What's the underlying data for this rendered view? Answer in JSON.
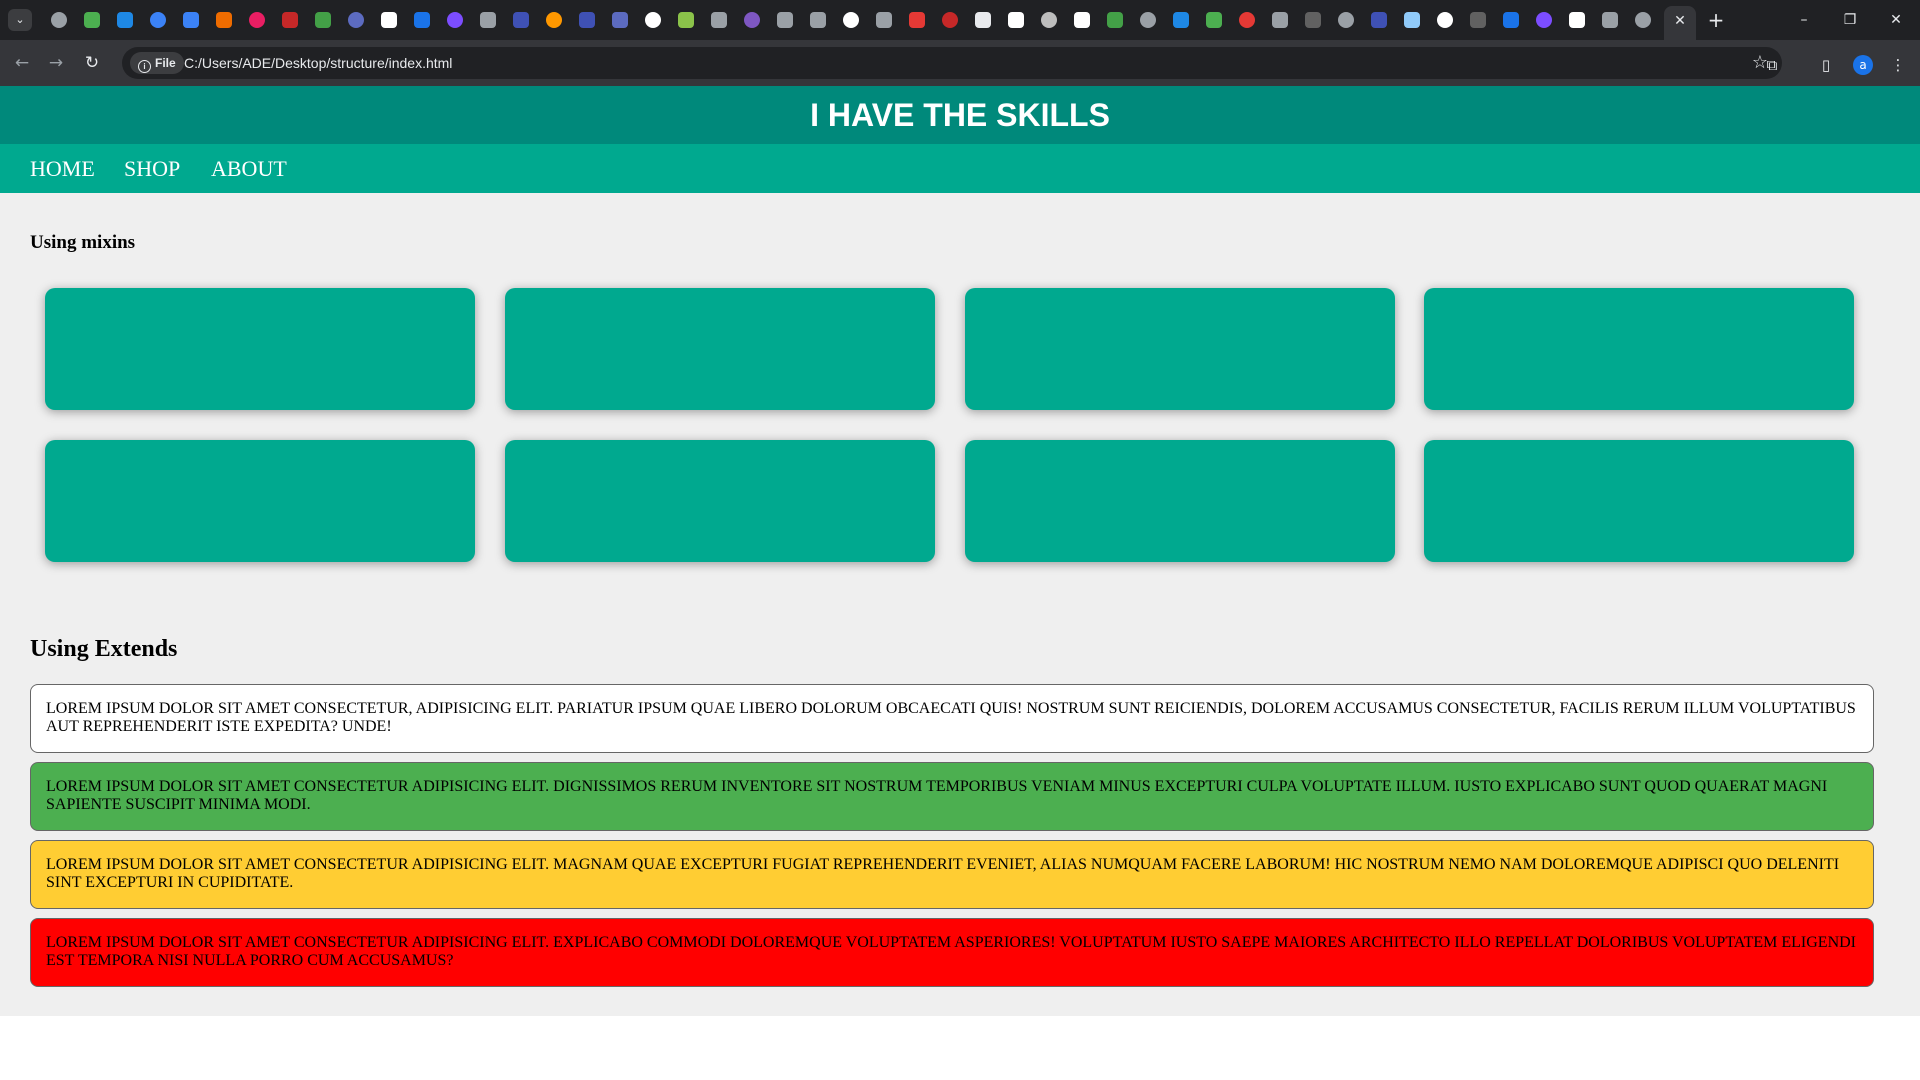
{
  "browser": {
    "tab_menu_glyph": "⌄",
    "active_tab_close": "✕",
    "new_tab": "+",
    "window_controls": {
      "minimize": "–",
      "restore": "❐",
      "close": "✕"
    },
    "file_chip": "File",
    "url": "C:/Users/ADE/Desktop/structure/index.html",
    "profile_initial": "a",
    "favicon_colors": [
      "#9aa0a6",
      "#4caf50",
      "#1e88e5",
      "#3b82f6",
      "#3b82f6",
      "#ef6c00",
      "#e91e63",
      "#c62828",
      "#43a047",
      "#5c6bc0",
      "#ffffff",
      "#1a73e8",
      "#7c4dff",
      "#9aa0a6",
      "#3f51b5",
      "#ff9800",
      "#3f51b5",
      "#5c6bc0",
      "#ffffff",
      "#8bc34a",
      "#9aa0a6",
      "#7e57c2",
      "#9aa0a6",
      "#9aa0a6",
      "#ffffff",
      "#9aa0a6",
      "#e53935",
      "#c62828",
      "#e8eaed",
      "#ffffff",
      "#bdbdbd",
      "#ffffff",
      "#43a047",
      "#9aa0a6",
      "#1e88e5",
      "#4caf50",
      "#e53935",
      "#9aa0a6",
      "#616161",
      "#9aa0a6",
      "#3f51b5",
      "#90caf9",
      "#ffffff",
      "#616161",
      "#1a73e8",
      "#7c4dff",
      "#ffffff",
      "#9aa0a6",
      "#9aa0a6"
    ]
  },
  "site": {
    "title": "I HAVE THE SKILLS",
    "nav": [
      "HOME",
      "SHOP",
      "ABOUT"
    ],
    "mixins_heading": "Using mixins",
    "extends_heading": "Using Extends",
    "box_color": "#00a98f",
    "messages": [
      {
        "text": "Lorem ipsum dolor sit amet consectetur, adipisicing elit. Pariatur ipsum quae libero dolorum obcaecati quis! Nostrum sunt reiciendis, dolorem accusamus consectetur, facilis rerum illum voluptatibus aut reprehenderit iste expedita? Unde!",
        "color": "#ffffff"
      },
      {
        "text": "Lorem ipsum dolor sit amet consectetur adipisicing elit. Dignissimos rerum inventore sit nostrum temporibus veniam minus excepturi culpa voluptate illum. Iusto explicabo sunt quod quaerat magni sapiente suscipit minima modi.",
        "color": "#4caf50"
      },
      {
        "text": "Lorem ipsum dolor sit amet consectetur adipisicing elit. Magnam quae excepturi fugiat reprehenderit eveniet, alias numquam facere laborum! Hic nostrum nemo nam doloremque adipisci quo deleniti sint excepturi in cupiditate.",
        "color": "#ffcd33"
      },
      {
        "text": "Lorem ipsum dolor sit amet consectetur adipisicing elit. Explicabo commodi doloremque voluptatem asperiores! Voluptatum iusto saepe maiores architecto illo repellat doloribus voluptatem eligendi est tempora nisi nulla porro cum accusamus?",
        "color": "#ff0000"
      }
    ]
  }
}
